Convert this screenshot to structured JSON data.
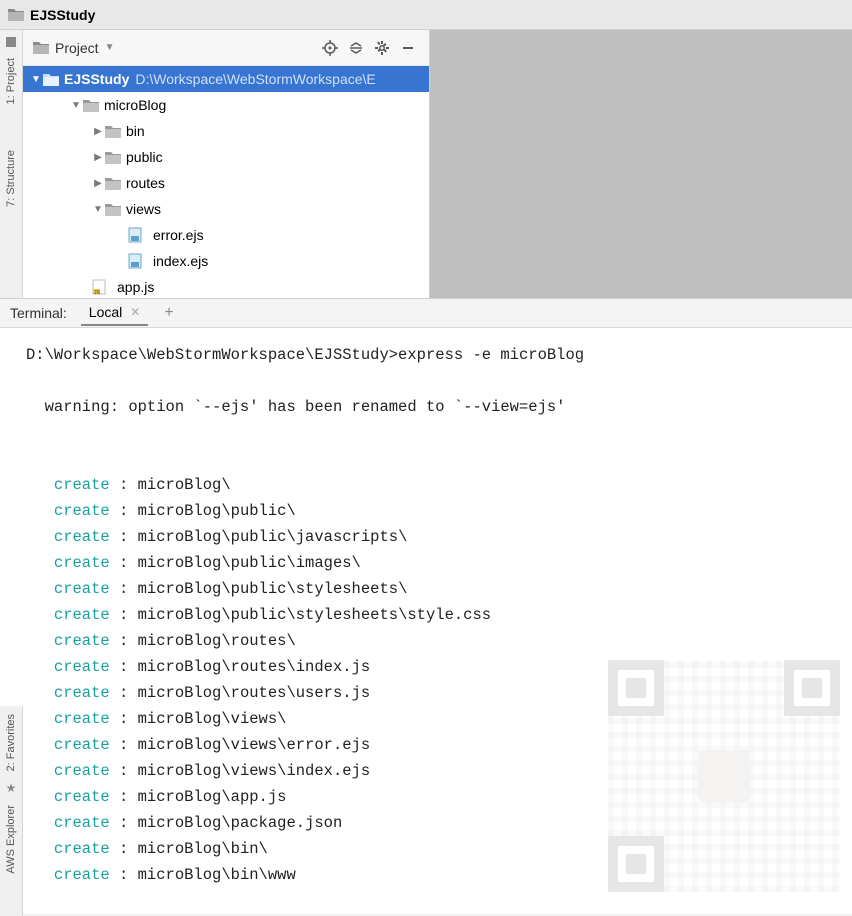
{
  "titlebar": {
    "title": "EJSStudy"
  },
  "leftRail": {
    "project": "1: Project",
    "structure": "7: Structure",
    "favorites": "2: Favorites",
    "aws": "AWS Explorer"
  },
  "projectPanel": {
    "label": "Project",
    "root": {
      "name": "EJSStudy",
      "path": "D:\\Workspace\\WebStormWorkspace\\E"
    },
    "tree": [
      {
        "depth": 1,
        "type": "folder",
        "expanded": true,
        "label": "microBlog"
      },
      {
        "depth": 2,
        "type": "folder",
        "expanded": false,
        "label": "bin"
      },
      {
        "depth": 2,
        "type": "folder",
        "expanded": false,
        "label": "public"
      },
      {
        "depth": 2,
        "type": "folder",
        "expanded": false,
        "label": "routes"
      },
      {
        "depth": 2,
        "type": "folder",
        "expanded": true,
        "label": "views"
      },
      {
        "depth": 3,
        "type": "ejs",
        "label": "error.ejs"
      },
      {
        "depth": 3,
        "type": "ejs",
        "label": "index.ejs"
      },
      {
        "depth": 2,
        "type": "js",
        "label": "app.js"
      }
    ]
  },
  "terminalHeader": {
    "title": "Terminal:",
    "tab": "Local"
  },
  "terminal": {
    "prompt": "D:\\Workspace\\WebStormWorkspace\\EJSStudy>express -e microBlog",
    "warning": "  warning: option `--ejs' has been renamed to `--view=ejs'",
    "createKeyword": "create",
    "lines": [
      "microBlog\\",
      "microBlog\\public\\",
      "microBlog\\public\\javascripts\\",
      "microBlog\\public\\images\\",
      "microBlog\\public\\stylesheets\\",
      "microBlog\\public\\stylesheets\\style.css",
      "microBlog\\routes\\",
      "microBlog\\routes\\index.js",
      "microBlog\\routes\\users.js",
      "microBlog\\views\\",
      "microBlog\\views\\error.ejs",
      "microBlog\\views\\index.ejs",
      "microBlog\\app.js",
      "microBlog\\package.json",
      "microBlog\\bin\\",
      "microBlog\\bin\\www"
    ]
  }
}
